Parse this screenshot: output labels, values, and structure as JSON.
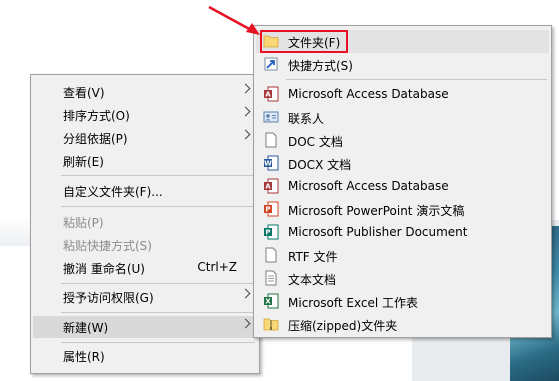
{
  "context_menu": {
    "items": [
      {
        "label": "查看(V)",
        "submenu": true
      },
      {
        "label": "排序方式(O)",
        "submenu": true
      },
      {
        "label": "分组依据(P)",
        "submenu": true
      },
      {
        "label": "刷新(E)"
      },
      {
        "label": "自定义文件夹(F)..."
      },
      {
        "label": "粘贴(P)",
        "disabled": true
      },
      {
        "label": "粘贴快捷方式(S)",
        "disabled": true
      },
      {
        "label": "撤消 重命名(U)",
        "shortcut": "Ctrl+Z"
      },
      {
        "label": "授予访问权限(G)",
        "submenu": true
      },
      {
        "label": "新建(W)",
        "submenu": true,
        "highlighted": true
      },
      {
        "label": "属性(R)"
      }
    ]
  },
  "new_submenu": {
    "items": [
      {
        "label": "文件夹(F)",
        "icon": "folder-icon"
      },
      {
        "label": "快捷方式(S)",
        "icon": "shortcut-icon"
      },
      {
        "label": "Microsoft Access Database",
        "icon": "access-icon"
      },
      {
        "label": "联系人",
        "icon": "contact-icon"
      },
      {
        "label": "DOC 文档",
        "icon": "doc-icon"
      },
      {
        "label": "DOCX 文档",
        "icon": "word-icon"
      },
      {
        "label": "Microsoft Access Database",
        "icon": "access-icon"
      },
      {
        "label": "Microsoft PowerPoint 演示文稿",
        "icon": "powerpoint-icon"
      },
      {
        "label": "Microsoft Publisher Document",
        "icon": "publisher-icon"
      },
      {
        "label": "RTF 文件",
        "icon": "rtf-icon"
      },
      {
        "label": "文本文档",
        "icon": "text-document-icon"
      },
      {
        "label": "Microsoft Excel 工作表",
        "icon": "excel-icon"
      },
      {
        "label": "压缩(zipped)文件夹",
        "icon": "zip-folder-icon"
      }
    ]
  },
  "annotation_color": "#e81123"
}
